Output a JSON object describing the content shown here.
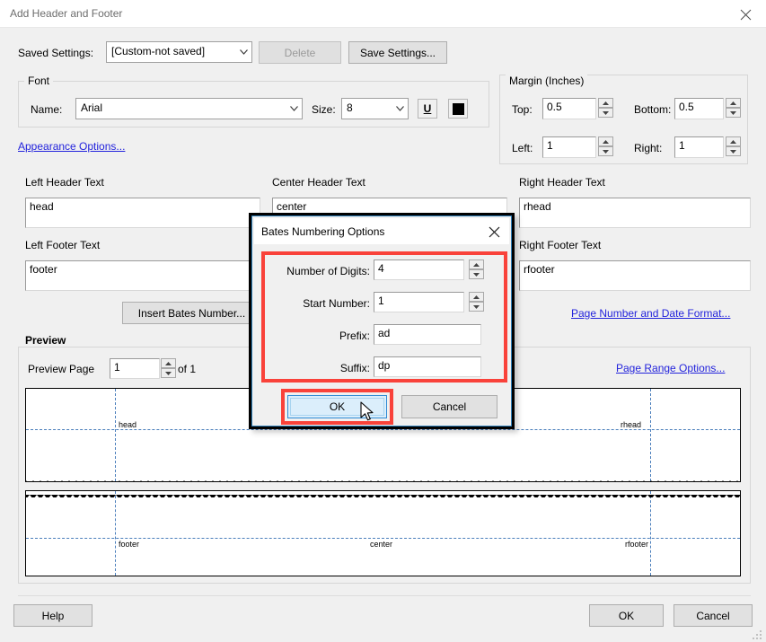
{
  "window": {
    "title": "Add Header and Footer",
    "close_icon": "close-icon"
  },
  "saved_settings": {
    "label": "Saved Settings:",
    "value": "[Custom-not saved]",
    "delete_label": "Delete",
    "save_label": "Save Settings..."
  },
  "font": {
    "group_title": "Font",
    "name_label": "Name:",
    "name_value": "Arial",
    "size_label": "Size:",
    "size_value": "8",
    "underline_icon": "underline-icon",
    "underline_label": "U",
    "color_icon": "font-color-swatch-icon",
    "appearance_link": "Appearance Options..."
  },
  "margin": {
    "group_title": "Margin (Inches)",
    "top_label": "Top:",
    "top_value": "0.5",
    "bottom_label": "Bottom:",
    "bottom_value": "0.5",
    "left_label": "Left:",
    "left_value": "1",
    "right_label": "Right:",
    "right_value": "1"
  },
  "headers": {
    "left_header_label": "Left Header Text",
    "left_header_value": "head",
    "center_header_label": "Center Header Text",
    "center_header_value": "center",
    "right_header_label": "Right Header Text",
    "right_header_value": "rhead",
    "left_footer_label": "Left Footer Text",
    "left_footer_value": "footer",
    "right_footer_label": "Right Footer Text",
    "right_footer_value": "rfooter"
  },
  "actions": {
    "insert_bates_label": "Insert Bates Number...",
    "page_number_format_link": "Page Number and Date Format...",
    "page_range_link": "Page Range Options..."
  },
  "preview": {
    "group_title": "Preview",
    "page_label": "Preview Page",
    "page_value": "1",
    "of_label": "of 1",
    "page1": {
      "left_text": "head",
      "right_text": "rhead"
    },
    "page2": {
      "left_text": "footer",
      "center_text": "center",
      "right_text": "rfooter"
    }
  },
  "footer_buttons": {
    "help": "Help",
    "ok": "OK",
    "cancel": "Cancel"
  },
  "modal": {
    "title": "Bates Numbering Options",
    "close_icon": "close-icon",
    "fields": [
      {
        "label": "Number of Digits:",
        "value": "4",
        "spinner": true
      },
      {
        "label": "Start Number:",
        "value": "1",
        "spinner": true
      },
      {
        "label": "Prefix:",
        "value": "ad",
        "spinner": false
      },
      {
        "label": "Suffix:",
        "value": "dp",
        "spinner": false
      }
    ],
    "ok_label": "OK",
    "cancel_label": "Cancel"
  },
  "colors": {
    "highlight_red": "#f9423a",
    "link_blue": "#2323dc",
    "focus_blue": "#2e8ad4",
    "guide_blue": "#4a7ebb"
  }
}
